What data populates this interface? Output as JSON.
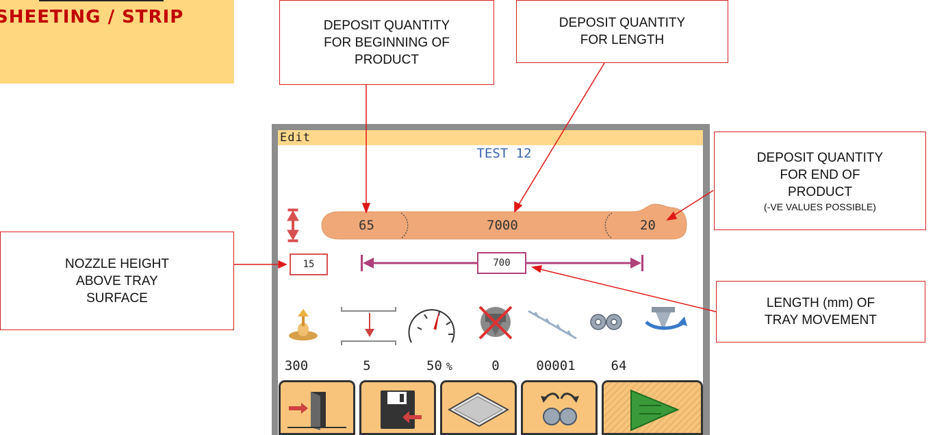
{
  "page_title": "SHEETING / STRIP",
  "callouts": {
    "deposit_begin": [
      "DEPOSIT QUANTITY",
      "FOR BEGINNING OF",
      "PRODUCT"
    ],
    "deposit_length": [
      "DEPOSIT QUANTITY",
      "FOR LENGTH"
    ],
    "deposit_end": [
      "DEPOSIT QUANTITY",
      "FOR END OF",
      "PRODUCT"
    ],
    "deposit_end_note": "(-VE VALUES POSSIBLE)",
    "nozzle_height": [
      "NOZZLE HEIGHT",
      "ABOVE TRAY",
      "SURFACE"
    ],
    "tray_length": [
      "LENGTH (mm) OF",
      "TRAY MOVEMENT"
    ]
  },
  "screen": {
    "menu_label": "Edit",
    "program_name": "TEST 12",
    "strip": {
      "begin_value": "65",
      "length_value": "7000",
      "end_value": "20"
    },
    "nozzle_height_value": "15",
    "tray_length_value": "700",
    "icons": [
      {
        "name": "deposit-speed-icon",
        "value": "300"
      },
      {
        "name": "tray-drop-icon",
        "value": "5"
      },
      {
        "name": "speed-gauge-icon",
        "value": "50",
        "unit": "%"
      },
      {
        "name": "disabled-nozzle-icon",
        "value": "0"
      },
      {
        "name": "wire-cut-icon",
        "value": "00001"
      },
      {
        "name": "gears-icon",
        "value": "64"
      },
      {
        "name": "nozzle-rotation-icon",
        "value": ""
      }
    ],
    "softkeys": [
      "exit-icon",
      "save-icon",
      "tray-icon",
      "gear-reverse-icon",
      "start-icon"
    ]
  },
  "colors": {
    "title_bg": "#ffd77e",
    "title_text": "#c00000",
    "callout_border": "#d42020",
    "strip_fill": "#f0a878",
    "measure_line": "#b0407a",
    "softkey_bg": "#f8c47b"
  }
}
